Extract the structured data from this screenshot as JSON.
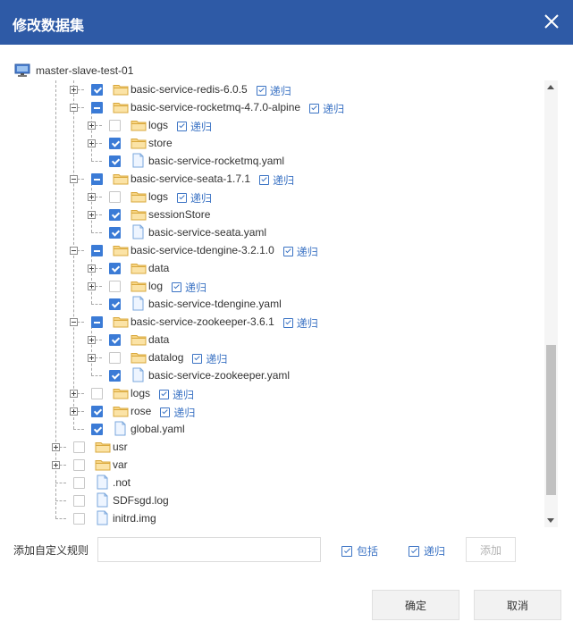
{
  "dialog": {
    "title": "修改数据集"
  },
  "tree": {
    "root_label": "master-slave-test-01",
    "recursive_label": "递归",
    "nodes": [
      {
        "label": "basic-service-redis-6.0.5",
        "type": "folder",
        "state": "checked",
        "recursive": true
      },
      {
        "label": "basic-service-rocketmq-4.7.0-alpine",
        "type": "folder",
        "state": "partial",
        "recursive": true
      },
      {
        "label": "logs",
        "type": "folder",
        "state": "unchecked",
        "recursive": true
      },
      {
        "label": "store",
        "type": "folder",
        "state": "checked",
        "recursive": false
      },
      {
        "label": "basic-service-rocketmq.yaml",
        "type": "file",
        "state": "checked",
        "recursive": false
      },
      {
        "label": "basic-service-seata-1.7.1",
        "type": "folder",
        "state": "partial",
        "recursive": true
      },
      {
        "label": "logs",
        "type": "folder",
        "state": "unchecked",
        "recursive": true
      },
      {
        "label": "sessionStore",
        "type": "folder",
        "state": "checked",
        "recursive": false
      },
      {
        "label": "basic-service-seata.yaml",
        "type": "file",
        "state": "checked",
        "recursive": false
      },
      {
        "label": "basic-service-tdengine-3.2.1.0",
        "type": "folder",
        "state": "partial",
        "recursive": true
      },
      {
        "label": "data",
        "type": "folder",
        "state": "checked",
        "recursive": false
      },
      {
        "label": "log",
        "type": "folder",
        "state": "unchecked",
        "recursive": true
      },
      {
        "label": "basic-service-tdengine.yaml",
        "type": "file",
        "state": "checked",
        "recursive": false
      },
      {
        "label": "basic-service-zookeeper-3.6.1",
        "type": "folder",
        "state": "partial",
        "recursive": true
      },
      {
        "label": "data",
        "type": "folder",
        "state": "checked",
        "recursive": false
      },
      {
        "label": "datalog",
        "type": "folder",
        "state": "unchecked",
        "recursive": true
      },
      {
        "label": "basic-service-zookeeper.yaml",
        "type": "file",
        "state": "checked",
        "recursive": false
      },
      {
        "label": "logs",
        "type": "folder",
        "state": "unchecked",
        "recursive": true
      },
      {
        "label": "rose",
        "type": "folder",
        "state": "checked",
        "recursive": true
      },
      {
        "label": "global.yaml",
        "type": "file",
        "state": "checked",
        "recursive": false
      },
      {
        "label": "usr",
        "type": "folder",
        "state": "unchecked",
        "recursive": false
      },
      {
        "label": "var",
        "type": "folder",
        "state": "unchecked",
        "recursive": false
      },
      {
        "label": ".not",
        "type": "file",
        "state": "unchecked",
        "recursive": false
      },
      {
        "label": "SDFsgd.log",
        "type": "file",
        "state": "unchecked",
        "recursive": false
      },
      {
        "label": "initrd.img",
        "type": "file",
        "state": "unchecked",
        "recursive": false
      }
    ]
  },
  "rule": {
    "label": "添加自定义规则",
    "input_value": "",
    "include_label": "包括",
    "recursive_label": "递归",
    "add_label": "添加"
  },
  "footer": {
    "ok_label": "确定",
    "cancel_label": "取消"
  },
  "colors": {
    "header": "#2e5aa6",
    "accent": "#3b7bd6",
    "link": "#3b73c4",
    "folder": "#f5c75a"
  }
}
